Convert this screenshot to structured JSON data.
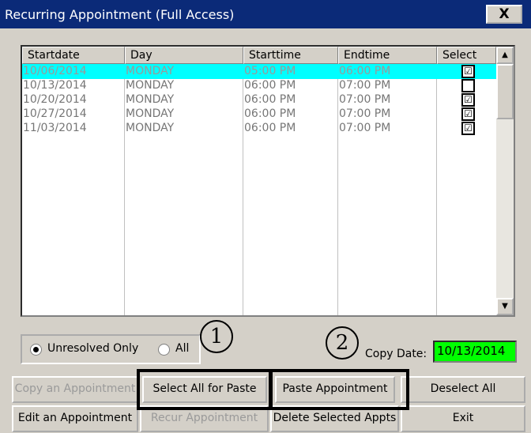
{
  "window": {
    "title": "Recurring Appointment (Full Access)",
    "close_label": "X"
  },
  "table": {
    "columns": [
      "Startdate",
      "Day",
      "Starttime",
      "Endtime",
      "Select"
    ],
    "rows": [
      {
        "startdate": "10/06/2014",
        "day": "MONDAY",
        "starttime": "05:00 PM",
        "endtime": "06:00 PM",
        "select": "☑",
        "selected": true
      },
      {
        "startdate": "10/13/2014",
        "day": "MONDAY",
        "starttime": "06:00 PM",
        "endtime": "07:00 PM",
        "select": "",
        "selected": false
      },
      {
        "startdate": "10/20/2014",
        "day": "MONDAY",
        "starttime": "06:00 PM",
        "endtime": "07:00 PM",
        "select": "☑",
        "selected": false
      },
      {
        "startdate": "10/27/2014",
        "day": "MONDAY",
        "starttime": "06:00 PM",
        "endtime": "07:00 PM",
        "select": "☑",
        "selected": false
      },
      {
        "startdate": "11/03/2014",
        "day": "MONDAY",
        "starttime": "06:00 PM",
        "endtime": "07:00 PM",
        "select": "☑",
        "selected": false
      }
    ],
    "scroll_up_icon": "▲",
    "scroll_down_icon": "▼"
  },
  "filter": {
    "unresolved_label": "Unresolved Only",
    "all_label": "All",
    "selected": "unresolved"
  },
  "annotations": {
    "one": "1",
    "two": "2"
  },
  "copy_date": {
    "label": "Copy Date:",
    "value": "10/13/2014"
  },
  "buttons": {
    "copy": "Copy an Appointment",
    "select_all": "Select All  for Paste",
    "paste": "Paste Appointment",
    "deselect": "Deselect All",
    "edit": "Edit an Appointment",
    "recur": "Recur Appointment",
    "delete": "Delete Selected Appts",
    "exit": "Exit"
  },
  "colors": {
    "title_bg": "#0b2a78",
    "selected_row": "#00ffff",
    "date_field": "#00ff00"
  }
}
